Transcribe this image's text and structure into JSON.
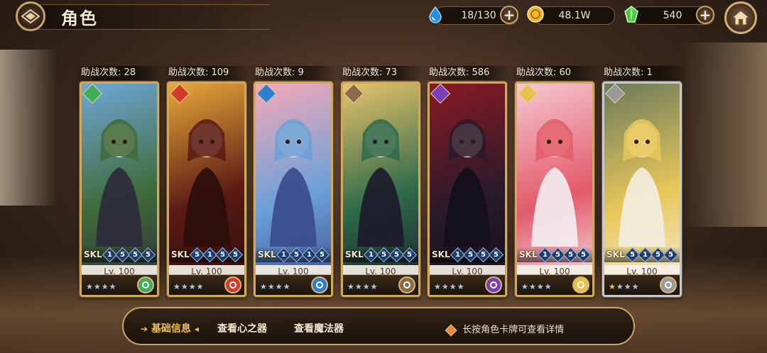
{
  "header": {
    "title": "角色",
    "back_icon": "diamond-back-icon",
    "home_icon": "home-icon"
  },
  "resources": [
    {
      "name": "stamina",
      "icon": "water-drop-icon",
      "value": "18/130",
      "has_plus": true,
      "plus_label": "+"
    },
    {
      "name": "gold",
      "icon": "coin-icon",
      "value": "48.1W",
      "has_plus": false
    },
    {
      "name": "gem",
      "icon": "green-crystal-icon",
      "value": "540",
      "has_plus": true,
      "plus_label": "+"
    }
  ],
  "cards": [
    {
      "support_label": "助战次数: 28",
      "element": "wind",
      "element_color": "#3fae5a",
      "skl_label": "SKL",
      "skl": [
        "1",
        "5",
        "5",
        "5"
      ],
      "level": "Lv. 100",
      "frame": "gold",
      "art_colors": [
        "#6fa7d8",
        "#3f6b3a",
        "#2c2a3a"
      ]
    },
    {
      "support_label": "助战次数: 109",
      "element": "fire",
      "element_color": "#d23a2a",
      "skl_label": "SKL",
      "skl": [
        "5",
        "1",
        "5",
        "5"
      ],
      "level": "Lv. 100",
      "frame": "gold",
      "art_colors": [
        "#e8a93a",
        "#5a1a14",
        "#2a0d0a"
      ]
    },
    {
      "support_label": "助战次数: 9",
      "element": "water",
      "element_color": "#2f7fd0",
      "skl_label": "SKL",
      "skl": [
        "1",
        "5",
        "1",
        "5"
      ],
      "level": "Lv. 100",
      "frame": "gold",
      "art_colors": [
        "#f5a9b8",
        "#6aa0d8",
        "#3a4a8a"
      ]
    },
    {
      "support_label": "助战次数: 73",
      "element": "earth",
      "element_color": "#8a6a48",
      "skl_label": "SKL",
      "skl": [
        "1",
        "5",
        "5",
        "5"
      ],
      "level": "Lv. 100",
      "frame": "gold",
      "art_colors": [
        "#e8c36a",
        "#2e6a4a",
        "#1c1a2a"
      ]
    },
    {
      "support_label": "助战次数: 586",
      "element": "dark",
      "element_color": "#7a3fb8",
      "skl_label": "SKL",
      "skl": [
        "1",
        "5",
        "5",
        "5"
      ],
      "level": "Lv. 100",
      "frame": "gold",
      "art_colors": [
        "#8a1a24",
        "#2a1a2a",
        "#121018"
      ]
    },
    {
      "support_label": "助战次数: 60",
      "element": "light",
      "element_color": "#e8c04a",
      "skl_label": "SKL",
      "skl": [
        "1",
        "5",
        "5",
        "5"
      ],
      "level": "Lv. 100",
      "frame": "gold",
      "art_colors": [
        "#f5c8d2",
        "#e35a6a",
        "#f3eef2"
      ]
    },
    {
      "support_label": "助战次数: 1",
      "element": "void",
      "element_color": "#9a9a9a",
      "skl_label": "SKL",
      "skl": [
        "5",
        "1",
        "5",
        "5"
      ],
      "level": "Lv. 100",
      "frame": "silver",
      "art_colors": [
        "#6a7a5a",
        "#e8c85a",
        "#f3ede0"
      ]
    }
  ],
  "bottom_panel": {
    "tabs": [
      {
        "label": "基础信息",
        "active": true
      },
      {
        "label": "查看心之器",
        "active": false
      },
      {
        "label": "查看魔法器",
        "active": false
      }
    ],
    "hint": "长按角色卡牌可查看详情",
    "hint_icon": "orange-diamond-icon"
  }
}
